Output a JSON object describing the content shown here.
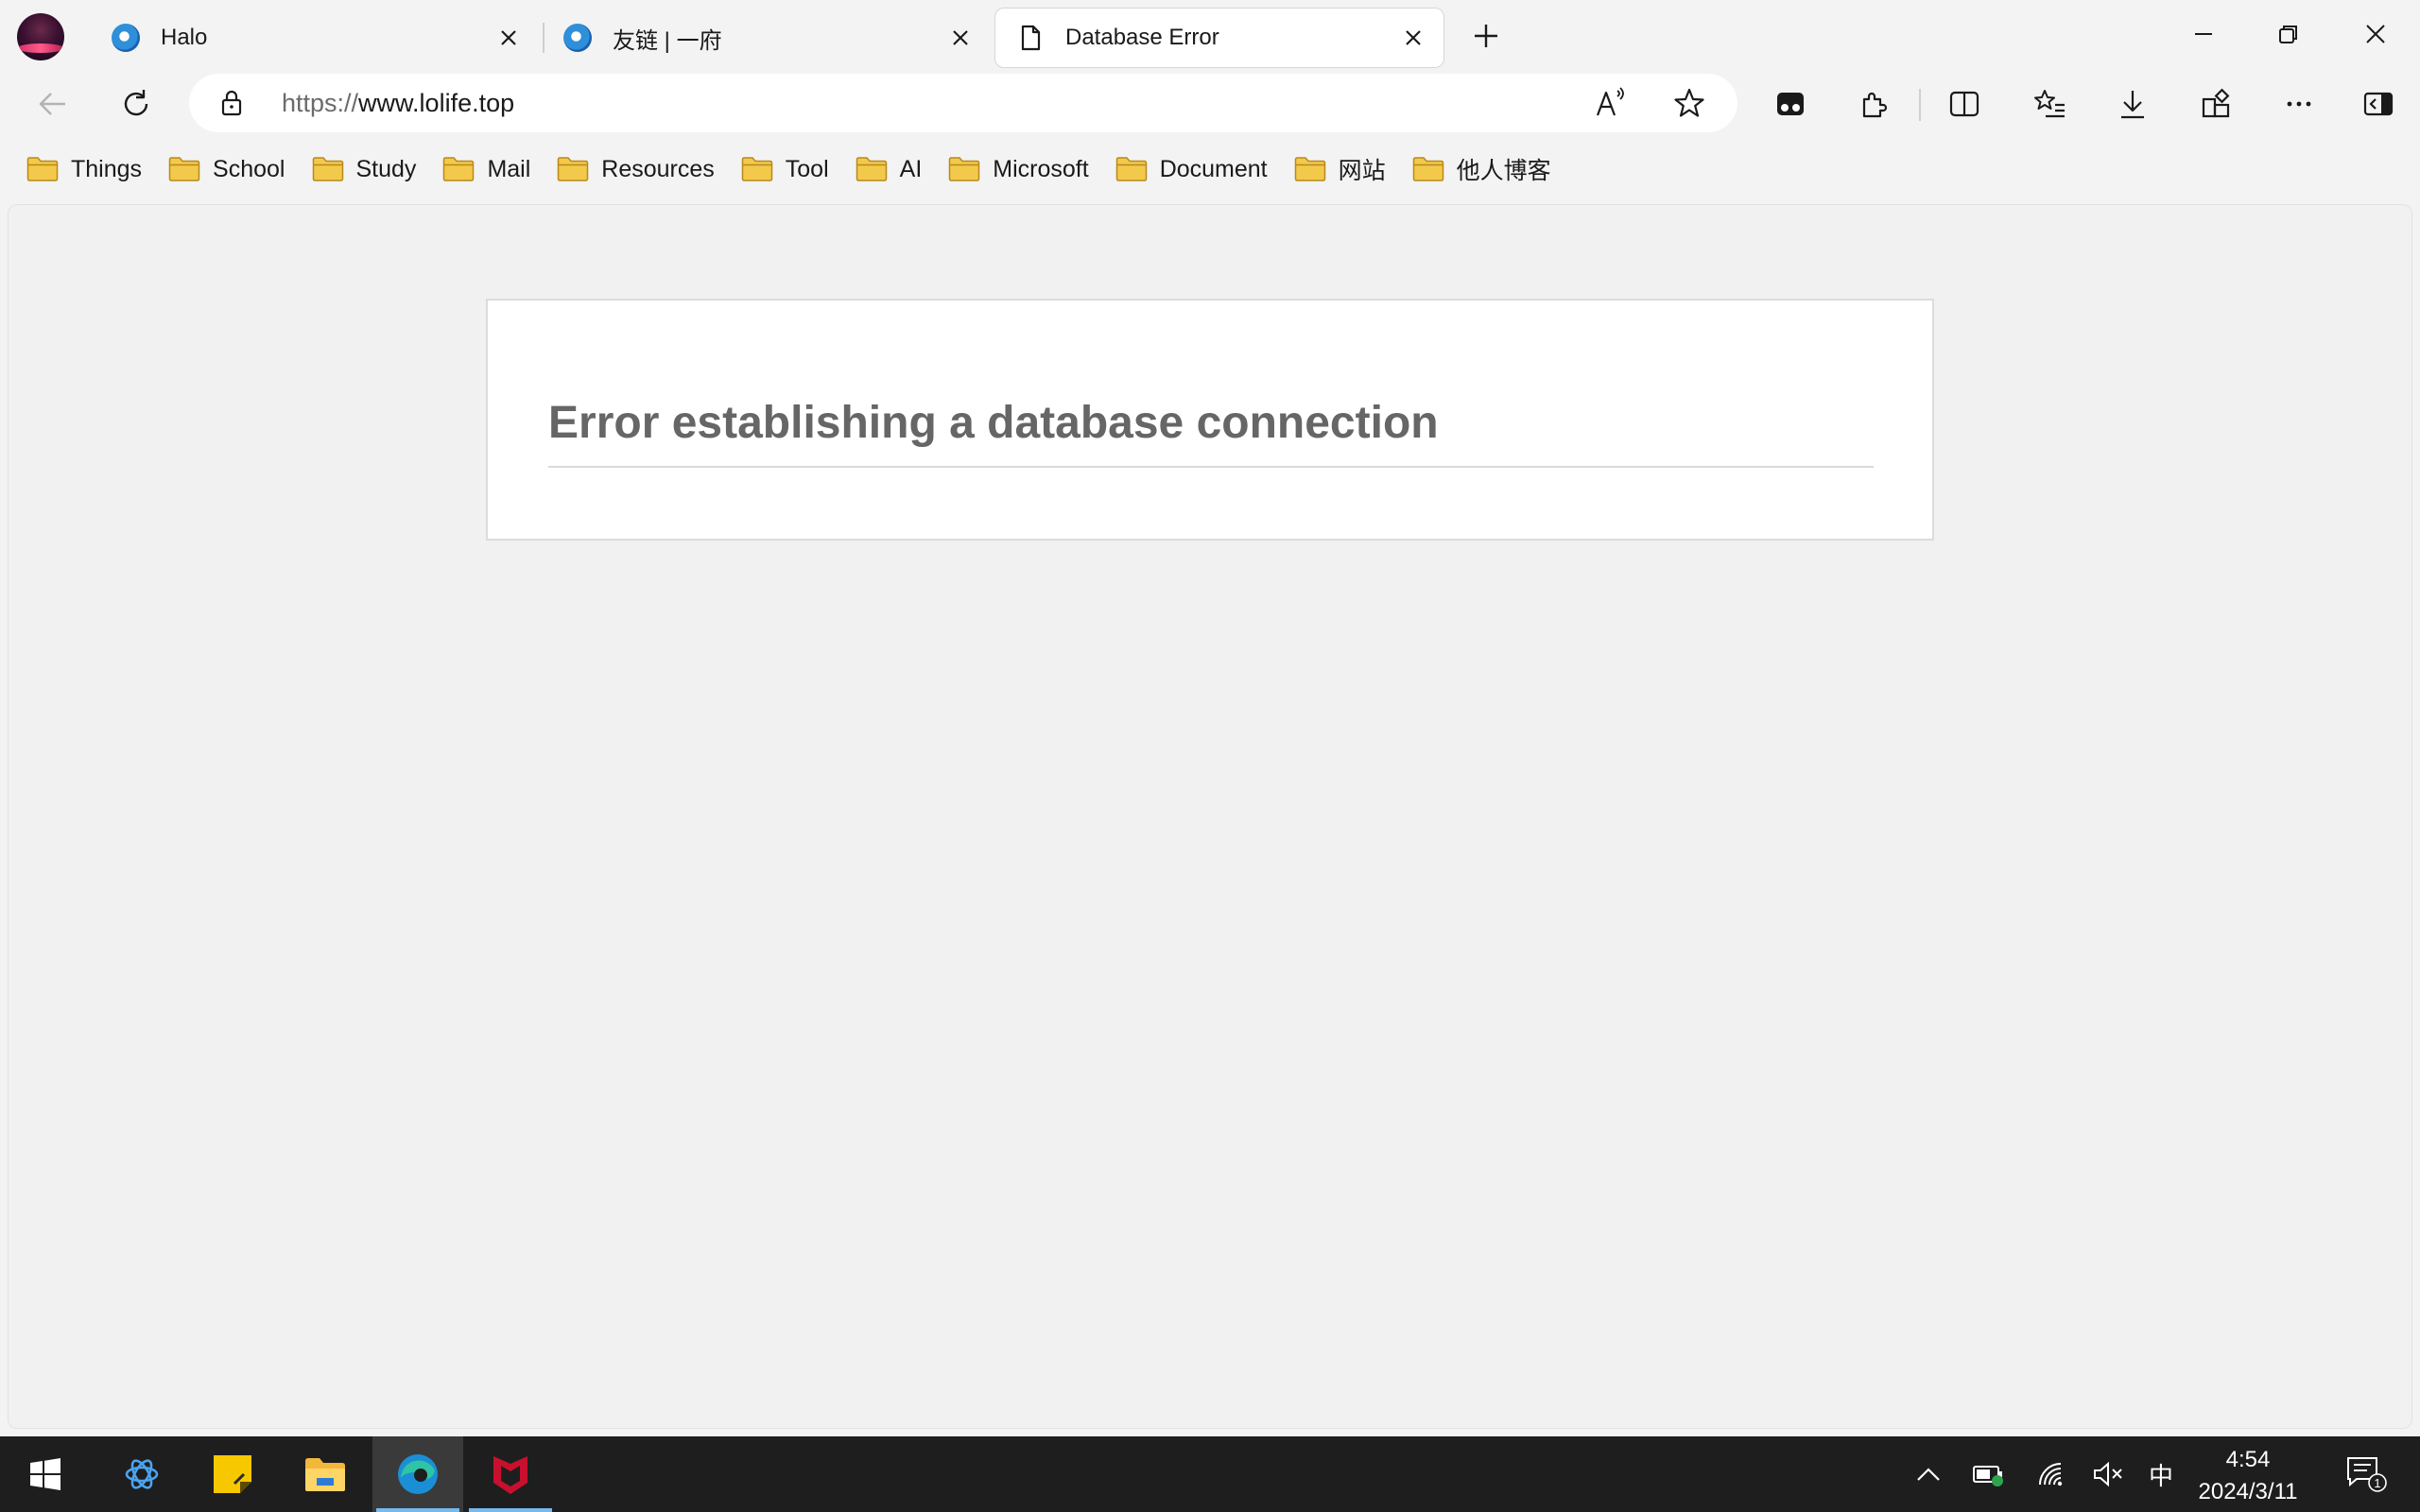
{
  "tabs": [
    {
      "title": "Halo",
      "icon": "edge-blue-icon",
      "active": false
    },
    {
      "title": "友链 | 一府",
      "icon": "edge-blue-icon",
      "active": false
    },
    {
      "title": "Database Error",
      "icon": "page-icon",
      "active": true
    }
  ],
  "address_bar": {
    "scheme": "https://",
    "host": "www.lolife.top"
  },
  "favorites": [
    {
      "label": "Things"
    },
    {
      "label": "School"
    },
    {
      "label": "Study"
    },
    {
      "label": "Mail"
    },
    {
      "label": "Resources"
    },
    {
      "label": "Tool"
    },
    {
      "label": "AI"
    },
    {
      "label": "Microsoft"
    },
    {
      "label": "Document"
    },
    {
      "label": "网站"
    },
    {
      "label": "他人博客"
    }
  ],
  "page": {
    "error_heading": "Error establishing a database connection"
  },
  "taskbar": {
    "apps": [
      "windows-start-icon",
      "chatgpt-icon",
      "sticky-notes-icon",
      "file-explorer-icon",
      "edge-icon",
      "mcafee-icon"
    ],
    "ime": "中",
    "time": "4:54",
    "date": "2024/3/11",
    "notification_count": "1"
  },
  "colors": {
    "folder": "#f3c94b",
    "folder_outline": "#b88a1b",
    "error_text": "#666666",
    "taskbar_bg": "#1e1e1e",
    "active_indicator": "#76b9ed"
  }
}
